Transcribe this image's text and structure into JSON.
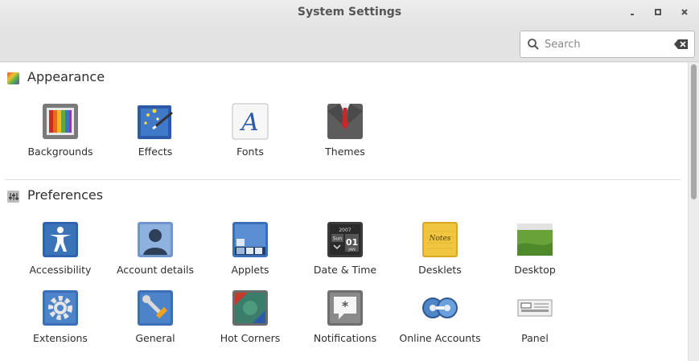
{
  "window": {
    "title": "System Settings"
  },
  "search": {
    "placeholder": "Search",
    "value": ""
  },
  "sections": {
    "appearance": {
      "title": "Appearance",
      "items": [
        "Backgrounds",
        "Effects",
        "Fonts",
        "Themes"
      ]
    },
    "preferences": {
      "title": "Preferences",
      "items": [
        "Accessibility",
        "Account details",
        "Applets",
        "Date & Time",
        "Desklets",
        "Desktop",
        "Extensions",
        "General",
        "Hot Corners",
        "Notifications",
        "Online Accounts",
        "Panel"
      ]
    }
  },
  "icons": {
    "fonts_glyph": "A",
    "datetime_year": "2007",
    "datetime_day": "Sun",
    "datetime_date": "01",
    "datetime_month": "JAN",
    "desklets_note": "Notes",
    "notifications_glyph": "*"
  },
  "colors": {
    "accent": "#3a73b8",
    "desklets": "#f0c640",
    "desktop": "#6aa23a"
  }
}
